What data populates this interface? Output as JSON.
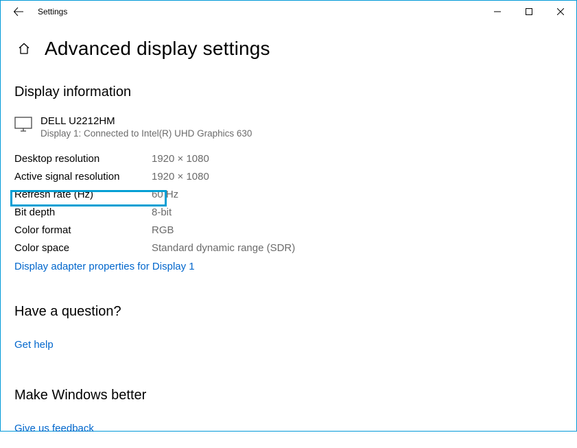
{
  "window": {
    "title": "Settings"
  },
  "page": {
    "title": "Advanced display settings"
  },
  "display_info": {
    "heading": "Display information",
    "monitor_name": "DELL U2212HM",
    "monitor_desc": "Display 1: Connected to Intel(R) UHD Graphics 630",
    "rows": [
      {
        "label": "Desktop resolution",
        "value": "1920 × 1080"
      },
      {
        "label": "Active signal resolution",
        "value": "1920 × 1080"
      },
      {
        "label": "Refresh rate (Hz)",
        "value": "60 Hz"
      },
      {
        "label": "Bit depth",
        "value": "8-bit"
      },
      {
        "label": "Color format",
        "value": "RGB"
      },
      {
        "label": "Color space",
        "value": "Standard dynamic range (SDR)"
      }
    ],
    "adapter_link": "Display adapter properties for Display 1"
  },
  "question": {
    "heading": "Have a question?",
    "link": "Get help"
  },
  "feedback": {
    "heading": "Make Windows better",
    "link": "Give us feedback"
  }
}
